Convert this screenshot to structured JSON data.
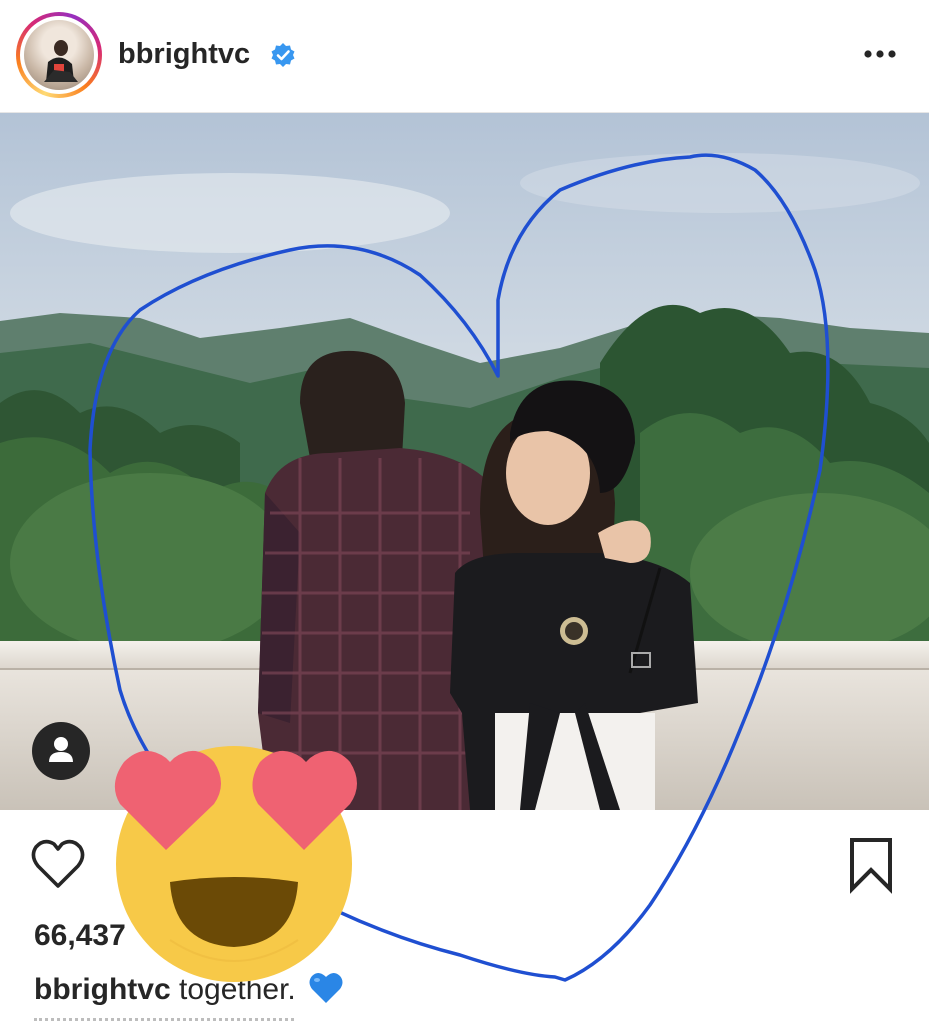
{
  "post": {
    "username": "bbrightvc",
    "verified": true,
    "likes_text": "66,437",
    "caption_user": "bbrightvc",
    "caption_text": " together.",
    "caption_emoji": "blue-heart"
  },
  "icons": {
    "more": "more-horizontal-icon",
    "like": "heart-outline-icon",
    "save": "bookmark-icon",
    "tagged_user": "user-tag-icon",
    "verified": "verified-badge-icon"
  },
  "colors": {
    "text": "#262626",
    "verified": "#3897f0",
    "drawn_heart": "#1f4fd1",
    "emoji_face": "#f7c948",
    "emoji_hearts": "#f05d6c"
  }
}
